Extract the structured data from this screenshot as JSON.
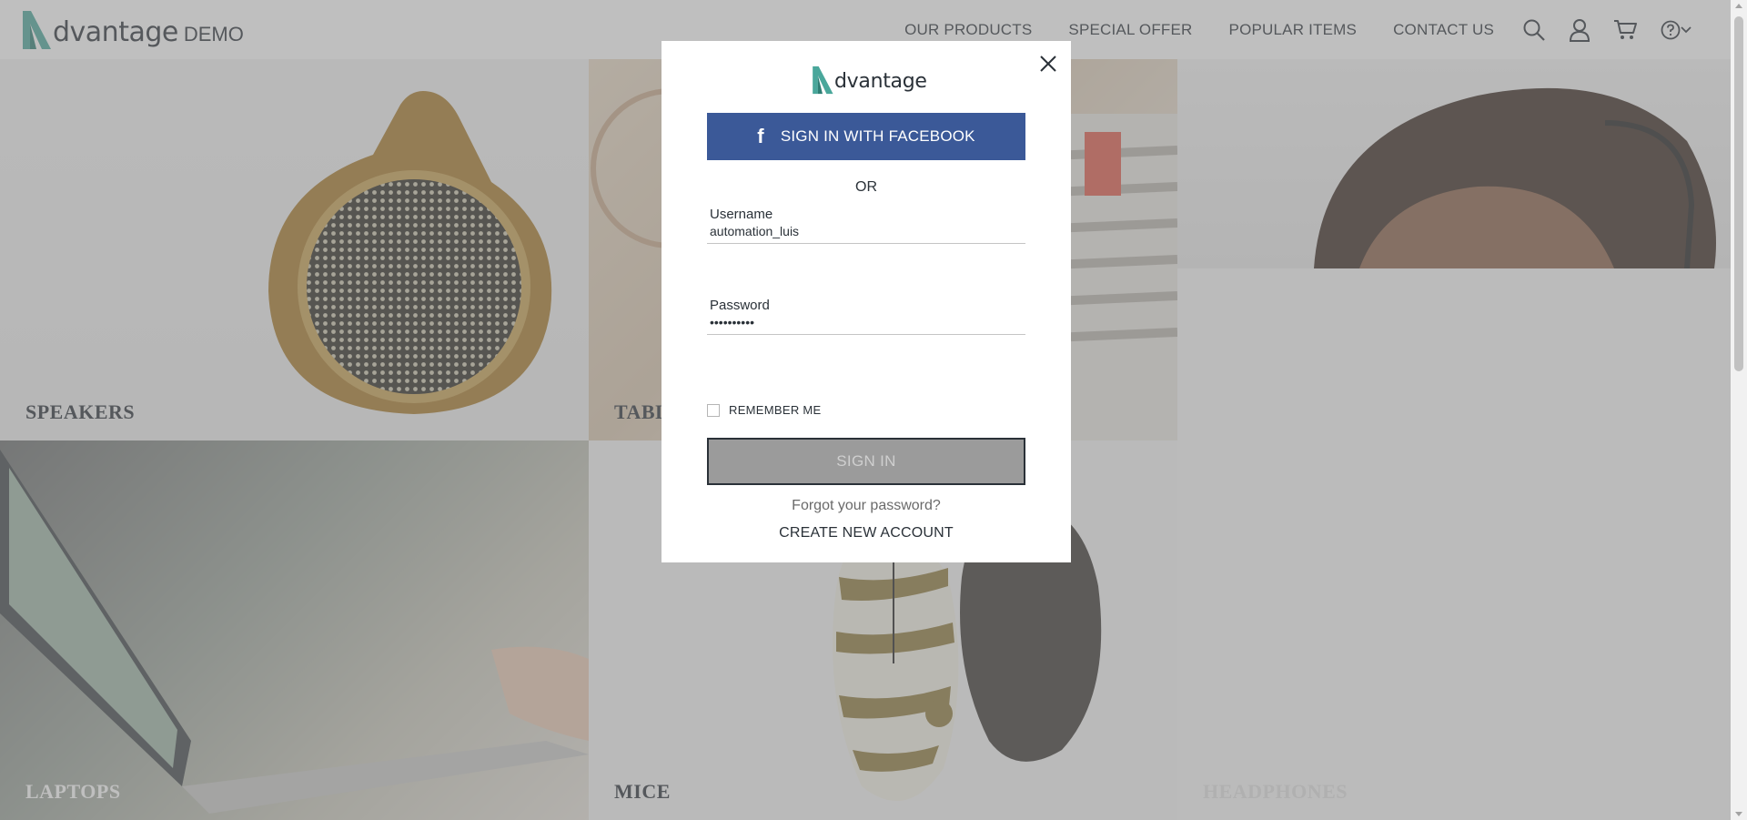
{
  "header": {
    "logo_word": "dvantage",
    "logo_demo": "DEMO",
    "nav": [
      "OUR PRODUCTS",
      "SPECIAL OFFER",
      "POPULAR ITEMS",
      "CONTACT US"
    ]
  },
  "categories": {
    "speakers": "SPEAKERS",
    "tablets": "TABLETS",
    "laptops": "LAPTOPS",
    "mice": "MICE",
    "headphones": "HEADPHONES"
  },
  "modal": {
    "logo_word": "dvantage",
    "facebook_icon": "f",
    "facebook_label": "SIGN IN WITH FACEBOOK",
    "or_label": "OR",
    "username_label": "Username",
    "username_value": "automation_luis",
    "password_label": "Password",
    "password_value": "••••••••••",
    "remember_label": "REMEMBER ME",
    "signin_label": "SIGN IN",
    "forgot_label": "Forgot your password?",
    "create_label": "CREATE NEW ACCOUNT"
  },
  "colors": {
    "accent": "#4aa79b",
    "facebook": "#3b5998",
    "text": "#2a3138",
    "overlay": "rgba(128,128,128,0.5)"
  },
  "icons": [
    "search-icon",
    "user-icon",
    "cart-icon",
    "help-icon",
    "chevron-down-icon",
    "close-icon",
    "facebook-icon"
  ]
}
